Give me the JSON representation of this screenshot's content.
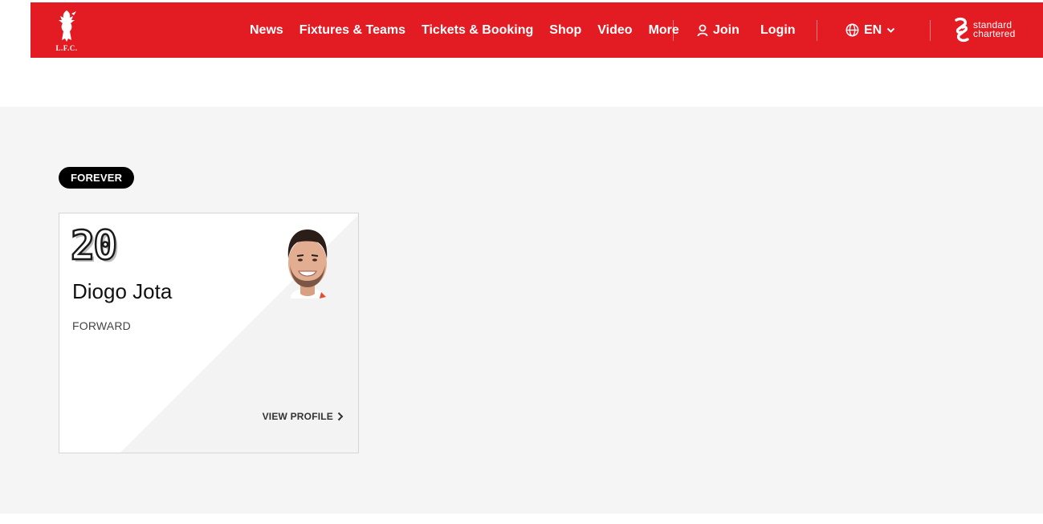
{
  "header": {
    "logo_text": "L.F.C.",
    "nav": [
      "News",
      "Fixtures & Teams",
      "Tickets & Booking",
      "Shop",
      "Video",
      "More"
    ],
    "join_label": "Join",
    "login_label": "Login",
    "language": "EN",
    "sponsor_line1": "standard",
    "sponsor_line2": "chartered"
  },
  "section": {
    "badge": "FOREVER"
  },
  "player": {
    "number": "20",
    "name": "Diogo Jota",
    "position": "FORWARD",
    "view_profile": "VIEW PROFILE"
  },
  "colors": {
    "brand_red": "#e31b23",
    "page_gray": "#f5f5f5",
    "badge_black": "#000000"
  }
}
